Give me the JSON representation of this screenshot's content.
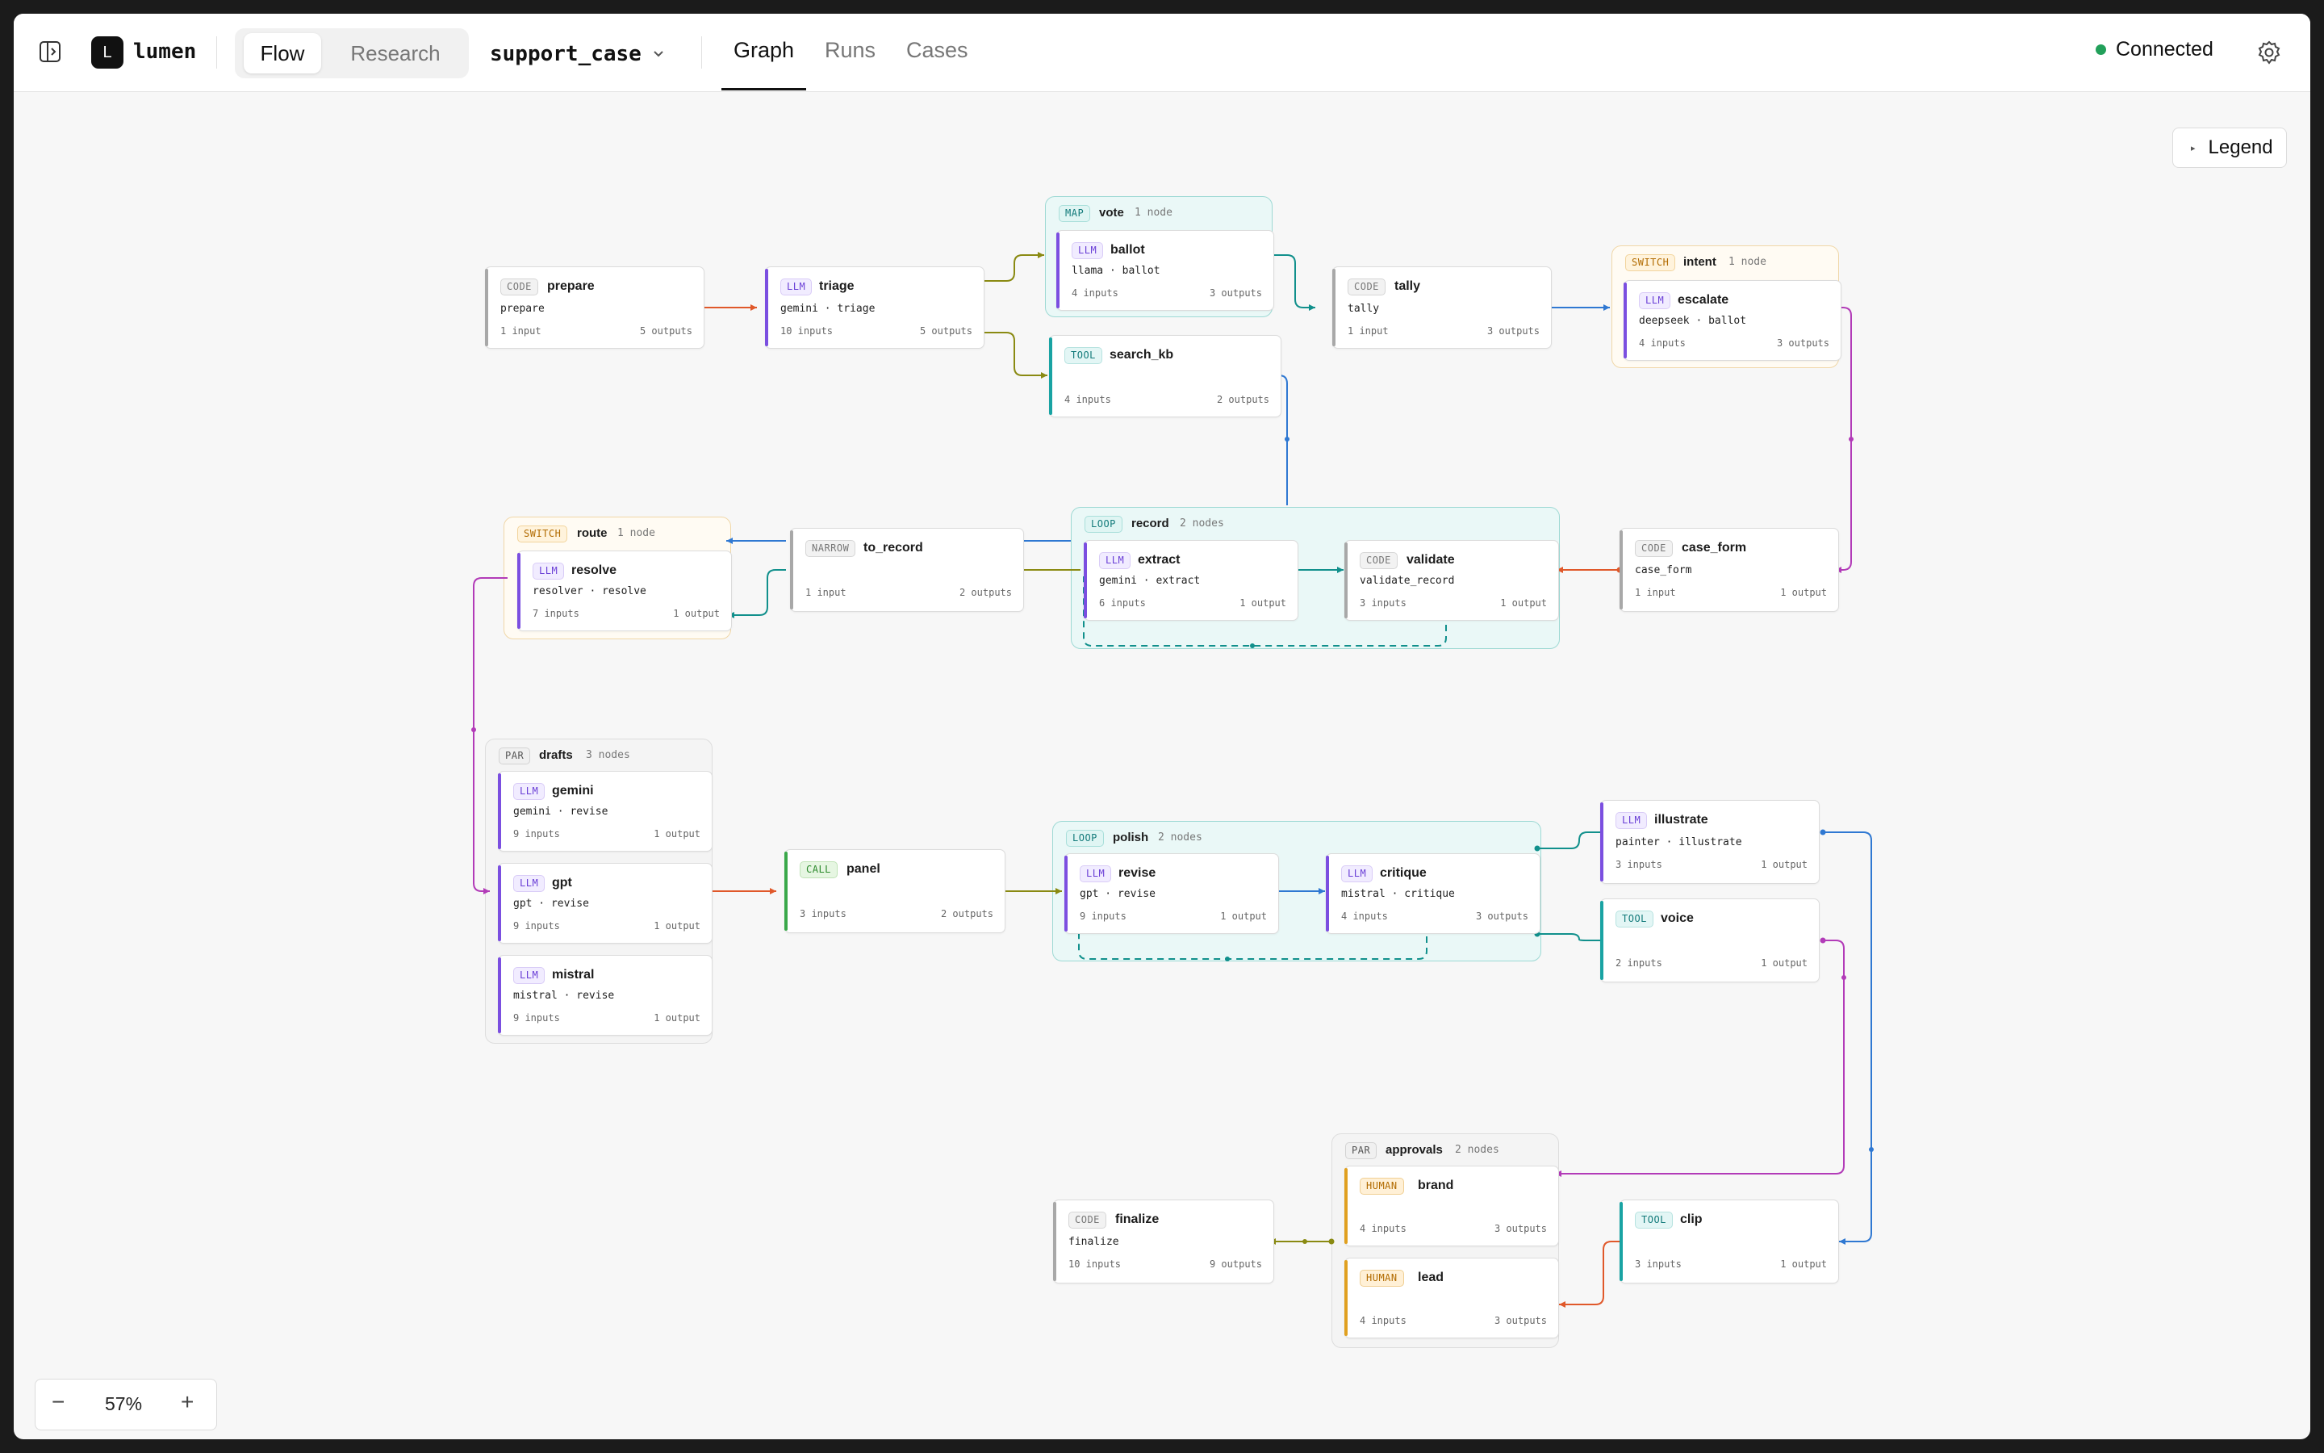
{
  "app": {
    "name": "lumen",
    "logo_letter": "L"
  },
  "mode_tabs": [
    "Flow",
    "Research"
  ],
  "active_mode": "Flow",
  "workflow": {
    "name": "support_case"
  },
  "view_tabs": [
    "Graph",
    "Runs",
    "Cases"
  ],
  "active_view": "Graph",
  "status": {
    "label": "Connected",
    "color": "#22a05a"
  },
  "legend_label": "Legend",
  "zoom": {
    "value": "57%",
    "minus": "−",
    "plus": "+"
  },
  "colors": {
    "llm": "#7b4fe0",
    "code": "#a8a8a8",
    "tool": "#19a3a3",
    "human": "#e0a020",
    "call": "#3aa84a",
    "narrow": "#a8a8a8",
    "edge_orange": "#e0582a",
    "edge_olive": "#8a8a12",
    "edge_teal": "#11908c",
    "edge_blue": "#2f78d2",
    "edge_purple": "#b23bb8"
  },
  "groups": {
    "vote": {
      "kind": "MAP",
      "name": "vote",
      "count": "1 node"
    },
    "intent": {
      "kind": "SWITCH",
      "name": "intent",
      "count": "1 node"
    },
    "record": {
      "kind": "LOOP",
      "name": "record",
      "count": "2 nodes"
    },
    "route": {
      "kind": "SWITCH",
      "name": "route",
      "count": "1 node"
    },
    "drafts": {
      "kind": "PAR",
      "name": "drafts",
      "count": "3 nodes"
    },
    "polish": {
      "kind": "LOOP",
      "name": "polish",
      "count": "2 nodes"
    },
    "approvals": {
      "kind": "PAR",
      "name": "approvals",
      "count": "2 nodes"
    }
  },
  "nodes": {
    "prepare": {
      "kind": "CODE",
      "name": "prepare",
      "sub": "prepare",
      "inputs": "1 input",
      "outputs": "5 outputs"
    },
    "triage": {
      "kind": "LLM",
      "name": "triage",
      "sub": "gemini · triage",
      "inputs": "10 inputs",
      "outputs": "5 outputs"
    },
    "ballot": {
      "kind": "LLM",
      "name": "ballot",
      "sub": "llama · ballot",
      "inputs": "4 inputs",
      "outputs": "3 outputs"
    },
    "search_kb": {
      "kind": "TOOL",
      "name": "search_kb",
      "sub": "",
      "inputs": "4 inputs",
      "outputs": "2 outputs"
    },
    "tally": {
      "kind": "CODE",
      "name": "tally",
      "sub": "tally",
      "inputs": "1 input",
      "outputs": "3 outputs"
    },
    "escalate": {
      "kind": "LLM",
      "name": "escalate",
      "sub": "deepseek · ballot",
      "inputs": "4 inputs",
      "outputs": "3 outputs"
    },
    "resolve": {
      "kind": "LLM",
      "name": "resolve",
      "sub": "resolver · resolve",
      "inputs": "7 inputs",
      "outputs": "1 output"
    },
    "to_record": {
      "kind": "NARROW",
      "name": "to_record",
      "sub": "",
      "inputs": "1 input",
      "outputs": "2 outputs"
    },
    "extract": {
      "kind": "LLM",
      "name": "extract",
      "sub": "gemini · extract",
      "inputs": "6 inputs",
      "outputs": "1 output"
    },
    "validate": {
      "kind": "CODE",
      "name": "validate",
      "sub": "validate_record",
      "inputs": "3 inputs",
      "outputs": "1 output"
    },
    "case_form": {
      "kind": "CODE",
      "name": "case_form",
      "sub": "case_form",
      "inputs": "1 input",
      "outputs": "1 output"
    },
    "gemini": {
      "kind": "LLM",
      "name": "gemini",
      "sub": "gemini · revise",
      "inputs": "9 inputs",
      "outputs": "1 output"
    },
    "gpt": {
      "kind": "LLM",
      "name": "gpt",
      "sub": "gpt · revise",
      "inputs": "9 inputs",
      "outputs": "1 output"
    },
    "mistral": {
      "kind": "LLM",
      "name": "mistral",
      "sub": "mistral · revise",
      "inputs": "9 inputs",
      "outputs": "1 output"
    },
    "panel": {
      "kind": "CALL",
      "name": "panel",
      "sub": "",
      "inputs": "3 inputs",
      "outputs": "2 outputs"
    },
    "revise": {
      "kind": "LLM",
      "name": "revise",
      "sub": "gpt · revise",
      "inputs": "9 inputs",
      "outputs": "1 output"
    },
    "critique": {
      "kind": "LLM",
      "name": "critique",
      "sub": "mistral · critique",
      "inputs": "4 inputs",
      "outputs": "3 outputs"
    },
    "illustrate": {
      "kind": "LLM",
      "name": "illustrate",
      "sub": "painter · illustrate",
      "inputs": "3 inputs",
      "outputs": "1 output"
    },
    "voice": {
      "kind": "TOOL",
      "name": "voice",
      "sub": "",
      "inputs": "2 inputs",
      "outputs": "1 output"
    },
    "brand": {
      "kind": "HUMAN",
      "name": "brand",
      "sub": "",
      "inputs": "4 inputs",
      "outputs": "3 outputs"
    },
    "lead": {
      "kind": "HUMAN",
      "name": "lead",
      "sub": "",
      "inputs": "4 inputs",
      "outputs": "3 outputs"
    },
    "finalize": {
      "kind": "CODE",
      "name": "finalize",
      "sub": "finalize",
      "inputs": "10 inputs",
      "outputs": "9 outputs"
    },
    "clip": {
      "kind": "TOOL",
      "name": "clip",
      "sub": "",
      "inputs": "3 inputs",
      "outputs": "1 output"
    }
  }
}
